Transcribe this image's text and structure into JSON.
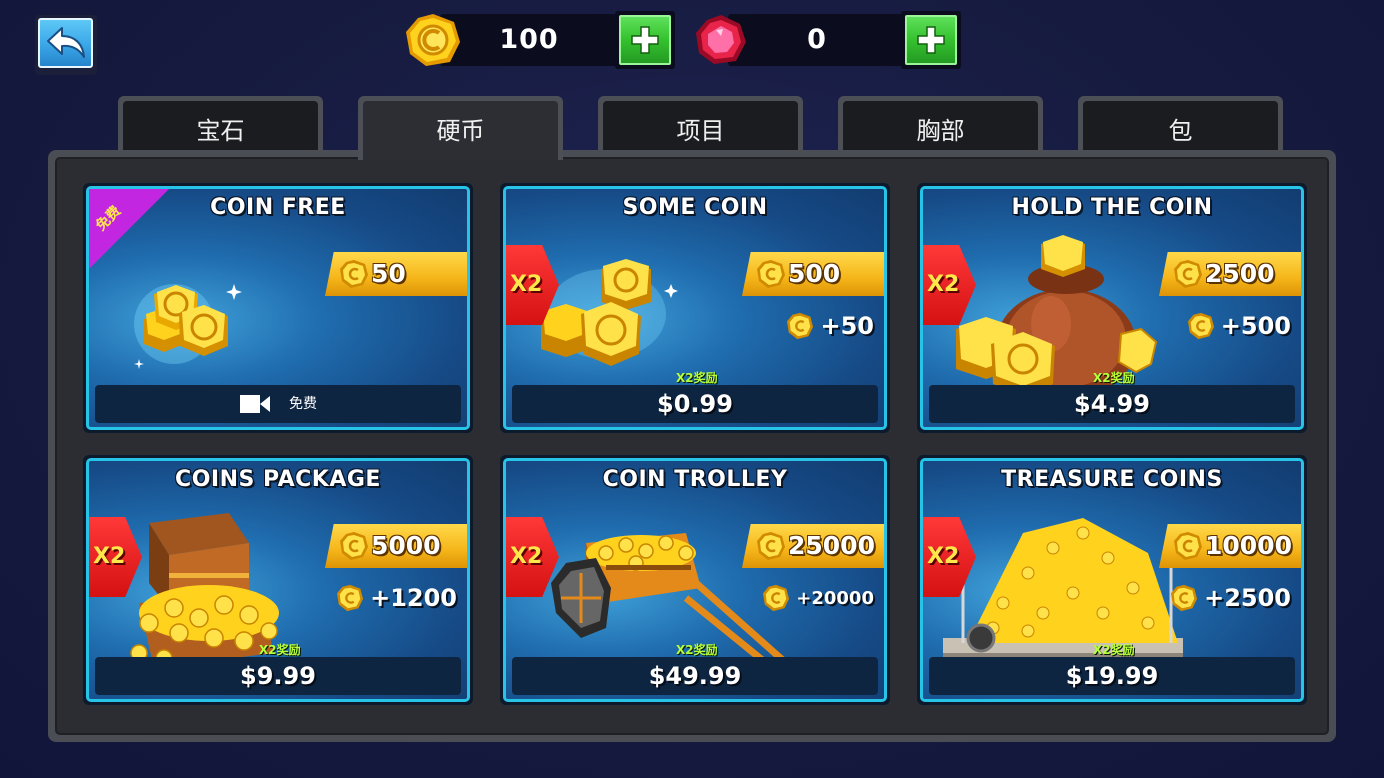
{
  "header": {
    "back_icon": "arrow-back-icon",
    "coins": {
      "icon": "coin-icon",
      "amount": "100"
    },
    "gems": {
      "icon": "gem-icon",
      "amount": "0"
    },
    "add_icon": "plus-icon"
  },
  "tabs": [
    {
      "label": "宝石",
      "active": false
    },
    {
      "label": "硬币",
      "active": true
    },
    {
      "label": "项目",
      "active": false
    },
    {
      "label": "胸部",
      "active": false
    },
    {
      "label": "包",
      "active": false
    }
  ],
  "offers": [
    {
      "title": "COIN FREE",
      "amount": "50",
      "bonus": "",
      "x2": false,
      "free_tag": "免费",
      "price": "",
      "video_label": "免费",
      "x2_bonus_tag": "",
      "art": "coins-stack-icon"
    },
    {
      "title": "SOME COIN",
      "amount": "500",
      "bonus": "+50",
      "x2": true,
      "x2_label": "X2",
      "price": "$0.99",
      "x2_bonus_tag": "X2奖励",
      "art": "coins-pile-icon"
    },
    {
      "title": "HOLD THE COIN",
      "amount": "2500",
      "bonus": "+500",
      "x2": true,
      "x2_label": "X2",
      "price": "$4.99",
      "x2_bonus_tag": "X2奖励",
      "art": "coin-sack-icon"
    },
    {
      "title": "COINS PACKAGE",
      "amount": "5000",
      "bonus": "+1200",
      "x2": true,
      "x2_label": "X2",
      "price": "$9.99",
      "x2_bonus_tag": "X2奖励",
      "art": "treasure-chest-icon"
    },
    {
      "title": "COIN TROLLEY",
      "amount": "25000",
      "bonus": "+20000",
      "x2": true,
      "x2_label": "X2",
      "price": "$49.99",
      "x2_bonus_tag": "X2奖励",
      "art": "coin-cart-icon"
    },
    {
      "title": "TREASURE COINS",
      "amount": "10000",
      "bonus": "+2500",
      "x2": true,
      "x2_label": "X2",
      "price": "$19.99",
      "x2_bonus_tag": "X2奖励",
      "art": "treasure-hoard-icon"
    }
  ],
  "colors": {
    "background": "#161a3e",
    "card_border": "#27c4e8",
    "ribbon_gold": "#f5b519",
    "x2_red": "#d51111",
    "plus_green": "#35c12f"
  }
}
